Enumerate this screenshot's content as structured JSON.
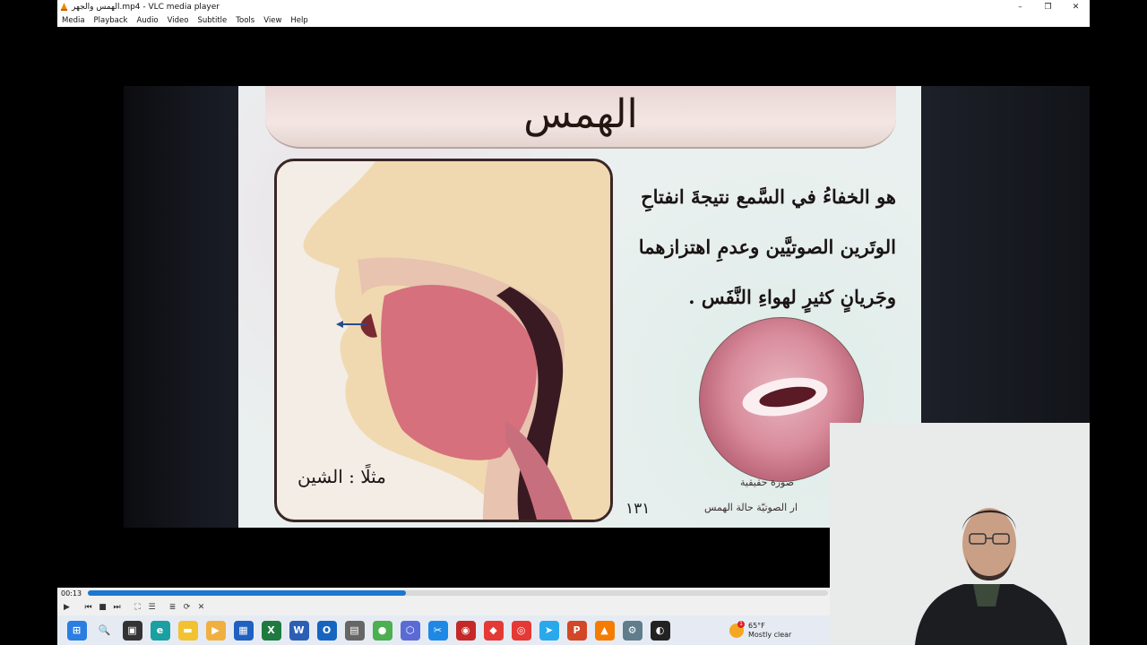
{
  "window": {
    "title": "الهمس والجهر.mp4 - VLC media player",
    "minimize": "–",
    "restore": "❐",
    "close": "✕"
  },
  "menu": [
    "Media",
    "Playback",
    "Audio",
    "Video",
    "Subtitle",
    "Tools",
    "View",
    "Help"
  ],
  "slide": {
    "heading": "الهمس",
    "definition_lines": [
      "هو الخفاءُ في السَّمع نتيجةَ انفتاحِ",
      "الوتَرين الصوتيَّين وعدمِ اهتزازهما",
      "وجَريانٍ كثيرٍ لهواءِ النَّفَس ."
    ],
    "example": "مثلًا : الشين",
    "caption_photo": "صورة حقيقية",
    "caption_state": "ار الصوتيّة حالة الهمس",
    "page_number": "١٣١"
  },
  "player": {
    "elapsed": "00:13",
    "progress": 0.43
  },
  "controls": [
    {
      "name": "play-icon",
      "glyph": "▶"
    },
    {
      "name": "previous-icon",
      "glyph": "⏮"
    },
    {
      "name": "stop-icon",
      "glyph": "■"
    },
    {
      "name": "next-icon",
      "glyph": "⏭"
    },
    {
      "name": "fullscreen-icon",
      "glyph": "⛶"
    },
    {
      "name": "extended-settings-icon",
      "glyph": "☰"
    },
    {
      "name": "playlist-icon",
      "glyph": "≣"
    },
    {
      "name": "loop-icon",
      "glyph": "⟳"
    },
    {
      "name": "shuffle-icon",
      "glyph": "✕"
    }
  ],
  "taskbar": {
    "apps": [
      {
        "name": "start-icon",
        "color": "#2a7de1",
        "glyph": "⊞"
      },
      {
        "name": "search-icon",
        "color": "#e6ebf3",
        "glyph": "🔍"
      },
      {
        "name": "task-view-icon",
        "color": "#333333",
        "glyph": "▣"
      },
      {
        "name": "edge-icon",
        "color": "#1aa0a0",
        "glyph": "e"
      },
      {
        "name": "file-explorer-icon",
        "color": "#f2c230",
        "glyph": "▬"
      },
      {
        "name": "media-app-icon",
        "color": "#f0b040",
        "glyph": "▶"
      },
      {
        "name": "store-icon",
        "color": "#2060c0",
        "glyph": "▦"
      },
      {
        "name": "excel-icon",
        "color": "#1f7a3f",
        "glyph": "X"
      },
      {
        "name": "word-icon",
        "color": "#2b5fb5",
        "glyph": "W"
      },
      {
        "name": "outlook-icon",
        "color": "#1565c0",
        "glyph": "O"
      },
      {
        "name": "calculator-icon",
        "color": "#666666",
        "glyph": "▤"
      },
      {
        "name": "circle-app-icon",
        "color": "#4caf50",
        "glyph": "●"
      },
      {
        "name": "hex-app-icon",
        "color": "#5b6bd6",
        "glyph": "⬡"
      },
      {
        "name": "snipping-tool-icon",
        "color": "#1e88e5",
        "glyph": "✂"
      },
      {
        "name": "red-app-icon",
        "color": "#c62828",
        "glyph": "◉"
      },
      {
        "name": "anydesk-icon",
        "color": "#e53935",
        "glyph": "◆"
      },
      {
        "name": "chrome-icon",
        "color": "#e53935",
        "glyph": "◎"
      },
      {
        "name": "telegram-icon",
        "color": "#29a9eb",
        "glyph": "➤"
      },
      {
        "name": "powerpoint-icon",
        "color": "#d24726",
        "glyph": "P"
      },
      {
        "name": "vlc-icon",
        "color": "#f57c00",
        "glyph": "▲"
      },
      {
        "name": "settings-icon",
        "color": "#607d8b",
        "glyph": "⚙"
      },
      {
        "name": "obs-icon",
        "color": "#222222",
        "glyph": "◐"
      }
    ],
    "weather": {
      "temp": "65°F",
      "condition": "Mostly clear",
      "badge": "1"
    }
  }
}
